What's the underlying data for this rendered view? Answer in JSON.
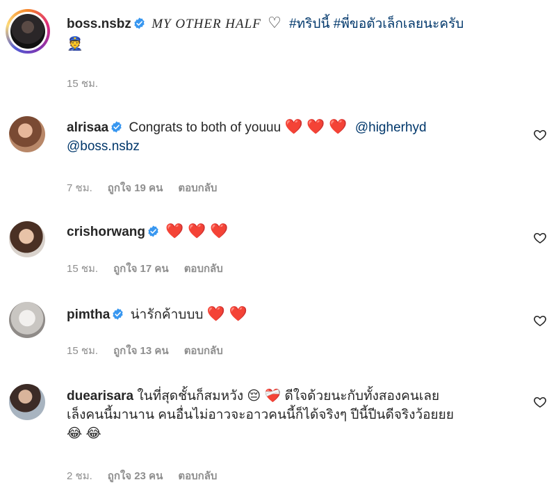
{
  "post": {
    "username": "boss.nsbz",
    "title": "MY OTHER HALF",
    "heart_outline": "♡",
    "tags": [
      "#ทริปนี้",
      "#พี่ขอตัวเล็กเลยนะครับ"
    ],
    "emoji": "👮",
    "time": "15 ชม."
  },
  "comments": [
    {
      "username": "alrisaa",
      "text": "Congrats to both of youuu",
      "hearts": "❤️ ❤️ ❤️",
      "mentions": [
        "@higherhyd",
        "@boss.nsbz"
      ],
      "time": "7 ชม.",
      "likes": "ถูกใจ 19 คน",
      "reply": "ตอบกลับ"
    },
    {
      "username": "crishorwang",
      "hearts": "❤️ ❤️ ❤️",
      "time": "15 ชม.",
      "likes": "ถูกใจ 17 คน",
      "reply": "ตอบกลับ"
    },
    {
      "username": "pimtha",
      "text": "น่ารักค้าบบบ",
      "hearts": "❤️ ❤️",
      "time": "15 ชม.",
      "likes": "ถูกใจ 13 คน",
      "reply": "ตอบกลับ"
    },
    {
      "username": "duearisara",
      "text_line1": "ในที่สุดชั้นก็สมหวัง",
      "emoji1": "😔 ❤️‍🩹",
      "text_line1b": "ดีใจด้วยนะกับทั้งสองคนเลย",
      "text_line2": "เล็งคนนี้มานาน คนอื่นไม่อาวจะอาวคนนี้ก็ได้จริงๆ ปีนี้ปีนดีจริงว้อยยย",
      "emoji2": "😂 😂",
      "time": "2 ชม.",
      "likes": "ถูกใจ 23 คน",
      "reply": "ตอบกลับ"
    }
  ],
  "colors": {
    "verified": "#3897f0",
    "link": "#00376b",
    "meta": "#8e8e8e"
  },
  "icons": {
    "verified": "verified-badge-icon",
    "like": "heart-outline-icon"
  }
}
